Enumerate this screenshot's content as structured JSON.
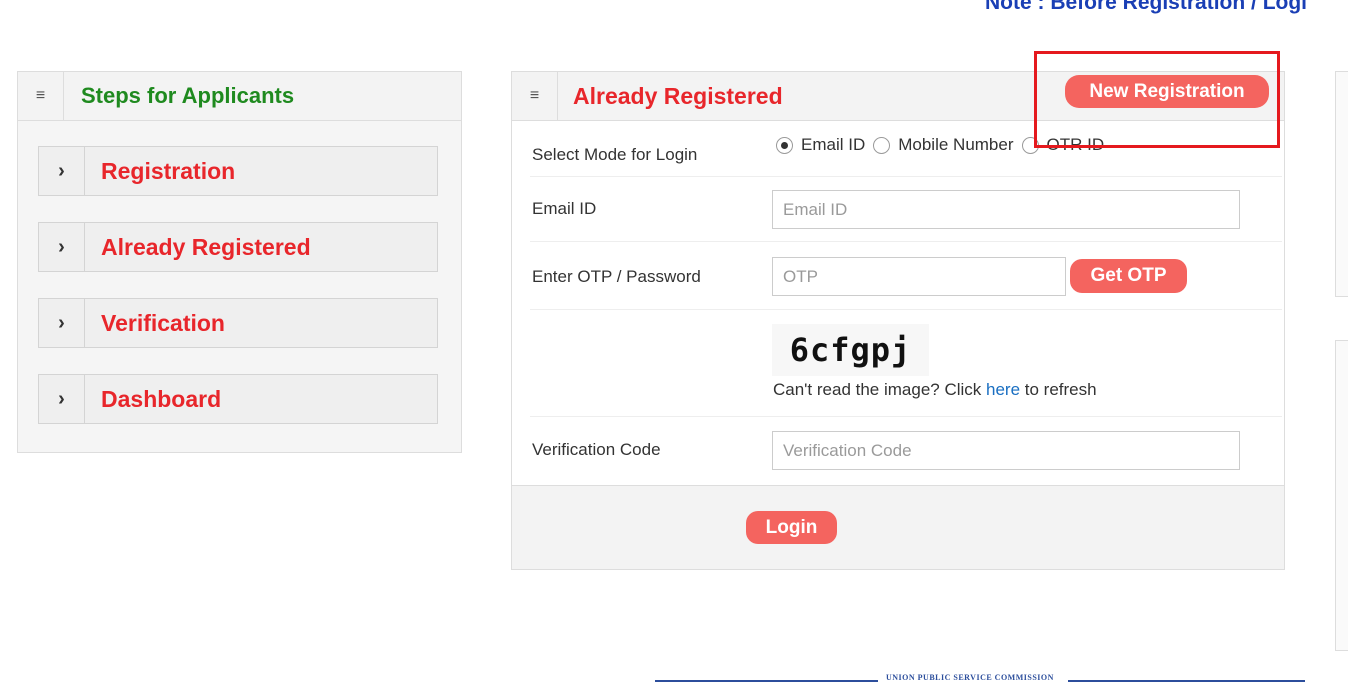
{
  "note_text": "Note : Before Registration / Logi",
  "steps_panel": {
    "title": "Steps for Applicants",
    "items": [
      {
        "label": "Registration"
      },
      {
        "label": "Already Registered"
      },
      {
        "label": "Verification"
      },
      {
        "label": "Dashboard"
      }
    ]
  },
  "login_panel": {
    "title": "Already Registered",
    "new_registration_label": "New Registration",
    "login_mode": {
      "label": "Select Mode for Login",
      "options": [
        "Email ID",
        "Mobile Number",
        "OTR ID"
      ],
      "selected": "Email ID"
    },
    "email": {
      "label": "Email ID",
      "placeholder": "Email ID",
      "value": ""
    },
    "otp": {
      "label": "Enter OTP / Password",
      "placeholder": "OTP",
      "value": "",
      "button_label": "Get OTP"
    },
    "captcha": {
      "text": "6cfgpj",
      "refresh_prefix": "Can't read the image? Click ",
      "refresh_link": "here",
      "refresh_suffix": " to refresh"
    },
    "verification": {
      "label": "Verification Code",
      "placeholder": "Verification Code",
      "value": ""
    },
    "login_button_label": "Login"
  },
  "footer_text": "UNION PUBLIC SERVICE COMMISSION",
  "colors": {
    "accent_red": "#e8262b",
    "button_red": "#f4645f",
    "title_green": "#1f8a1f",
    "note_blue": "#1a3fb5",
    "highlight_red": "#e5191e"
  }
}
